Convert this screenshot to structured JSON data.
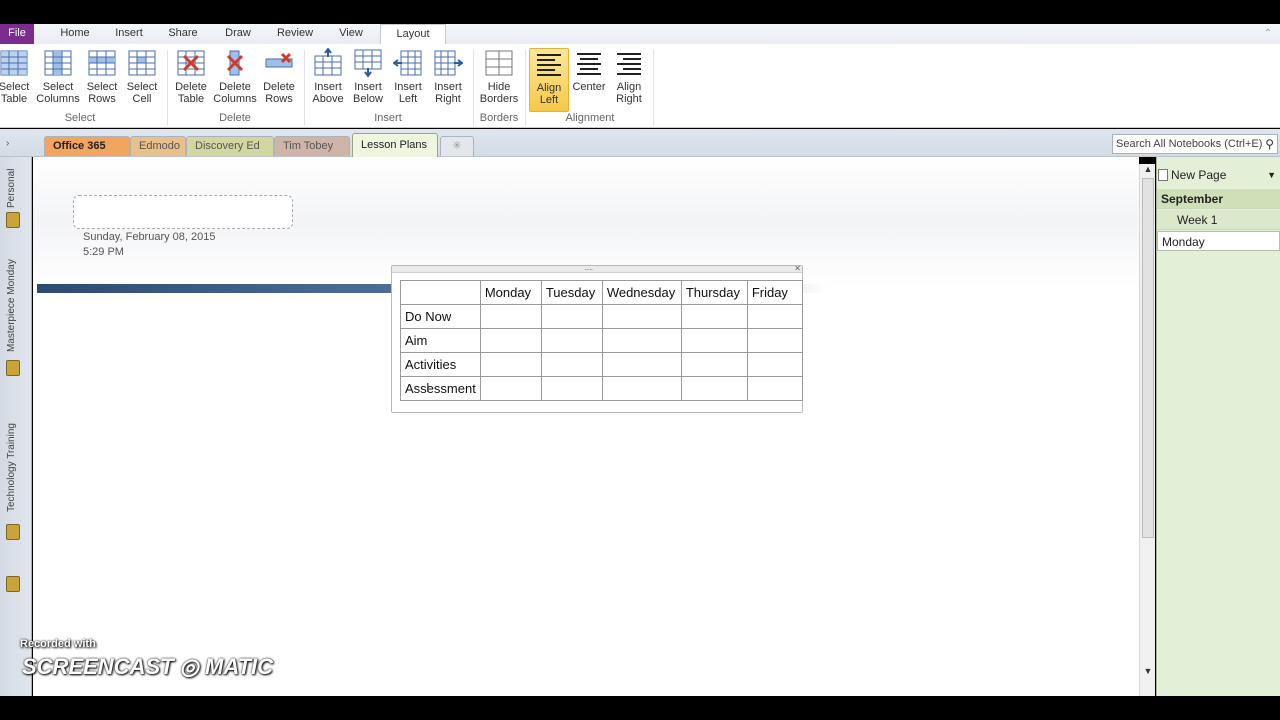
{
  "ribbon": {
    "file_tab": "File",
    "tabs": [
      "Home",
      "Insert",
      "Share",
      "Draw",
      "Review",
      "View",
      "Layout"
    ],
    "buttons": {
      "select_table": "Select\nTable",
      "select_columns": "Select\nColumns",
      "select_rows": "Select\nRows",
      "select_cell": "Select\nCell",
      "delete_table": "Delete\nTable",
      "delete_columns": "Delete\nColumns",
      "delete_rows": "Delete\nRows",
      "insert_above": "Insert\nAbove",
      "insert_below": "Insert\nBelow",
      "insert_left": "Insert\nLeft",
      "insert_right": "Insert\nRight",
      "hide_borders": "Hide\nBorders",
      "align_left": "Align\nLeft",
      "center": "Center",
      "align_right": "Align\nRight"
    },
    "groups": {
      "select": "Select",
      "delete": "Delete",
      "insert": "Insert",
      "borders": "Borders",
      "alignment": "Alignment"
    },
    "accent": "#7b2c8f"
  },
  "notebook": {
    "section_tabs": [
      "Office 365",
      "Edmodo",
      "Discovery Ed",
      "Tim Tobey",
      "Lesson Plans"
    ],
    "search_placeholder": "Search All Notebooks (Ctrl+E)",
    "left_labels": [
      "Personal",
      "Masterpiece Monday",
      "Technology Training"
    ]
  },
  "page": {
    "date": "Sunday, February 08, 2015",
    "time": "5:29 PM",
    "table": {
      "headers": [
        "",
        "Monday",
        "Tuesday",
        "Wednesday",
        "Thursday",
        "Friday"
      ],
      "rows": [
        "Do Now",
        "Aim",
        "Activities",
        "Assessment"
      ]
    }
  },
  "pages_pane": {
    "new_page": "New Page",
    "items": [
      "September",
      "Week 1",
      "Monday"
    ]
  },
  "watermark": {
    "line1": "Recorded with",
    "line2": "SCREENCAST ◎ MATIC"
  }
}
